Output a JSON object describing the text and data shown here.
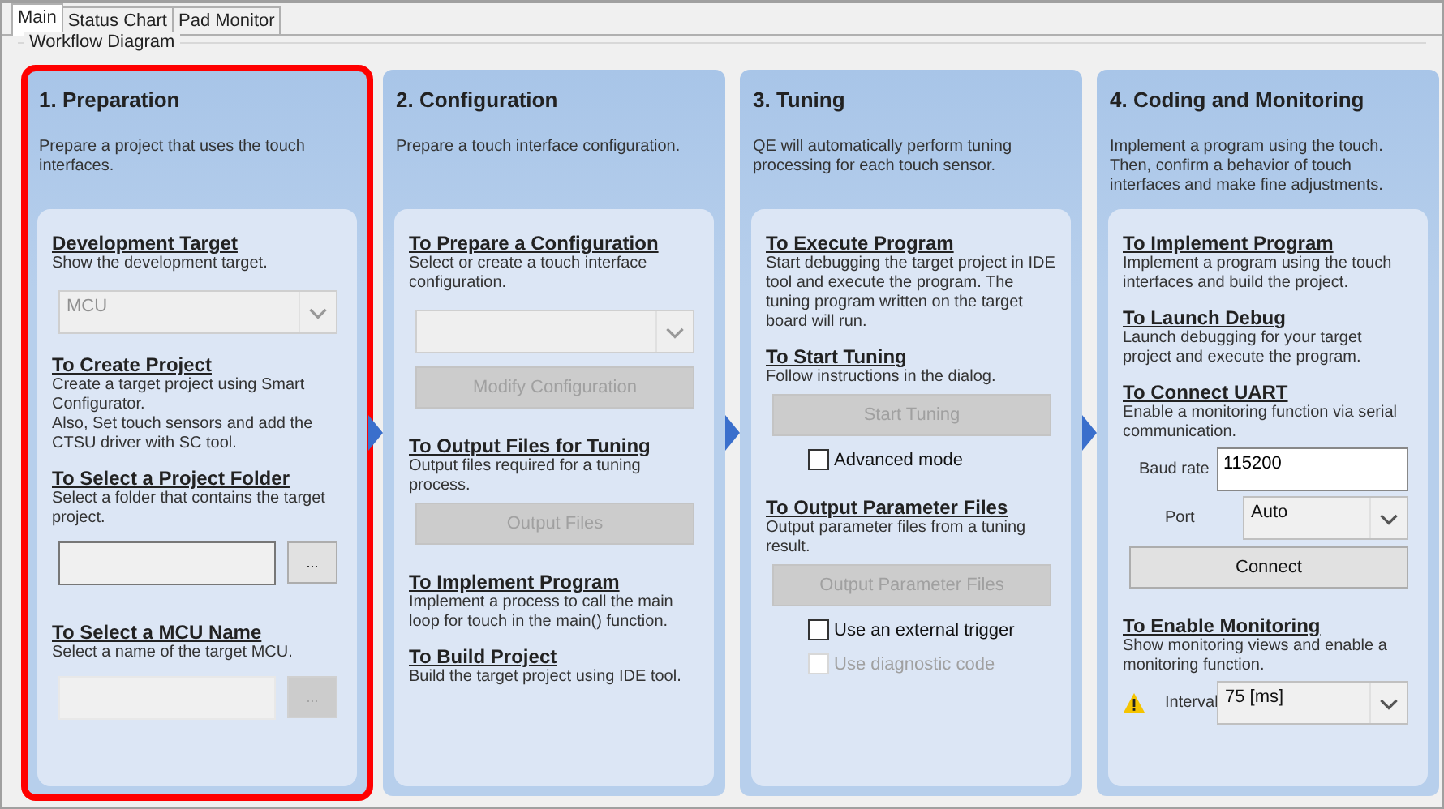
{
  "tabs": [
    {
      "label": "Main",
      "selected": true
    },
    {
      "label": "Status Chart",
      "selected": false
    },
    {
      "label": "Pad Monitor",
      "selected": false
    }
  ],
  "group_title": "Workflow Diagram",
  "columns": [
    {
      "title": "1. Preparation",
      "description": "Prepare a project that uses the touch interfaces.",
      "highlighted": true,
      "items": [
        {
          "kind": "section",
          "heading": "Development Target",
          "text": "Show the development target."
        },
        {
          "kind": "select",
          "value": "MCU",
          "disabled": true
        },
        {
          "kind": "section",
          "heading": "To Create Project",
          "text": "Create a target project using Smart Configurator.\nAlso, Set touch sensors and add the CTSU driver with SC tool."
        },
        {
          "kind": "section",
          "heading": "To Select a Project Folder",
          "text": "Select a folder that contains the target project."
        },
        {
          "kind": "browse",
          "button": "...",
          "disabled": false
        },
        {
          "kind": "section",
          "heading": "To Select a MCU Name",
          "text": "Select a name of the target MCU."
        },
        {
          "kind": "browse",
          "button": "...",
          "disabled": true
        }
      ]
    },
    {
      "title": "2. Configuration",
      "description": "Prepare a touch interface configuration.",
      "highlighted": false,
      "items": [
        {
          "kind": "section",
          "heading": "To Prepare a Configuration",
          "text": "Select or create a touch interface configuration."
        },
        {
          "kind": "select",
          "disabled": true
        },
        {
          "kind": "button",
          "label": "Modify Configuration",
          "disabled": true
        },
        {
          "kind": "section",
          "heading": "To Output Files for Tuning",
          "text": "Output files required for a tuning process."
        },
        {
          "kind": "button",
          "label": "Output Files",
          "disabled": true
        },
        {
          "kind": "section",
          "heading": "To Implement Program",
          "text": "Implement a process to call the main loop for touch in the main() function."
        },
        {
          "kind": "section",
          "heading": "To Build Project",
          "text": "Build the target project using IDE tool."
        }
      ]
    },
    {
      "title": "3. Tuning",
      "description": "QE will automatically perform tuning processing for each touch sensor.",
      "highlighted": false,
      "items": [
        {
          "kind": "section",
          "heading": "To Execute Program",
          "text": "Start debugging the target project in IDE tool and execute the program. The tuning program written on the target board will run."
        },
        {
          "kind": "section",
          "heading": "To Start Tuning",
          "text": "Follow instructions in the dialog."
        },
        {
          "kind": "button",
          "label": "Start Tuning",
          "disabled": true
        },
        {
          "kind": "checkbox",
          "label": "Advanced mode",
          "checked": false,
          "disabled": false
        },
        {
          "kind": "section",
          "heading": "To Output Parameter Files",
          "text": "Output parameter files from a tuning result."
        },
        {
          "kind": "button",
          "label": "Output Parameter Files",
          "disabled": true
        },
        {
          "kind": "checkbox",
          "label": "Use an external trigger",
          "checked": false,
          "disabled": false
        },
        {
          "kind": "checkbox",
          "label": "Use diagnostic code",
          "checked": false,
          "disabled": true
        }
      ]
    },
    {
      "title": "4. Coding and Monitoring",
      "description": "Implement a program using the touch. Then, confirm a behavior of touch interfaces and make fine adjustments.",
      "highlighted": false,
      "items": [
        {
          "kind": "section",
          "heading": "To Implement Program",
          "text": "Implement a program using the touch interfaces and build the project."
        },
        {
          "kind": "section",
          "heading": "To Launch Debug",
          "text": "Launch debugging for your target project and execute the program."
        },
        {
          "kind": "section",
          "heading": "To Connect UART",
          "text": "Enable a monitoring function via serial communication."
        },
        {
          "kind": "input_row",
          "label": "Baud rate",
          "value": "115200"
        },
        {
          "kind": "select_row",
          "label": "Port",
          "value": "Auto",
          "warning": false
        },
        {
          "kind": "button",
          "label": "Connect",
          "disabled": false
        },
        {
          "kind": "section",
          "heading": "To Enable Monitoring",
          "text": "Show monitoring views and enable a monitoring function."
        },
        {
          "kind": "select_row",
          "label": "Interval",
          "value": "75 [ms]",
          "warning": true
        }
      ]
    }
  ]
}
